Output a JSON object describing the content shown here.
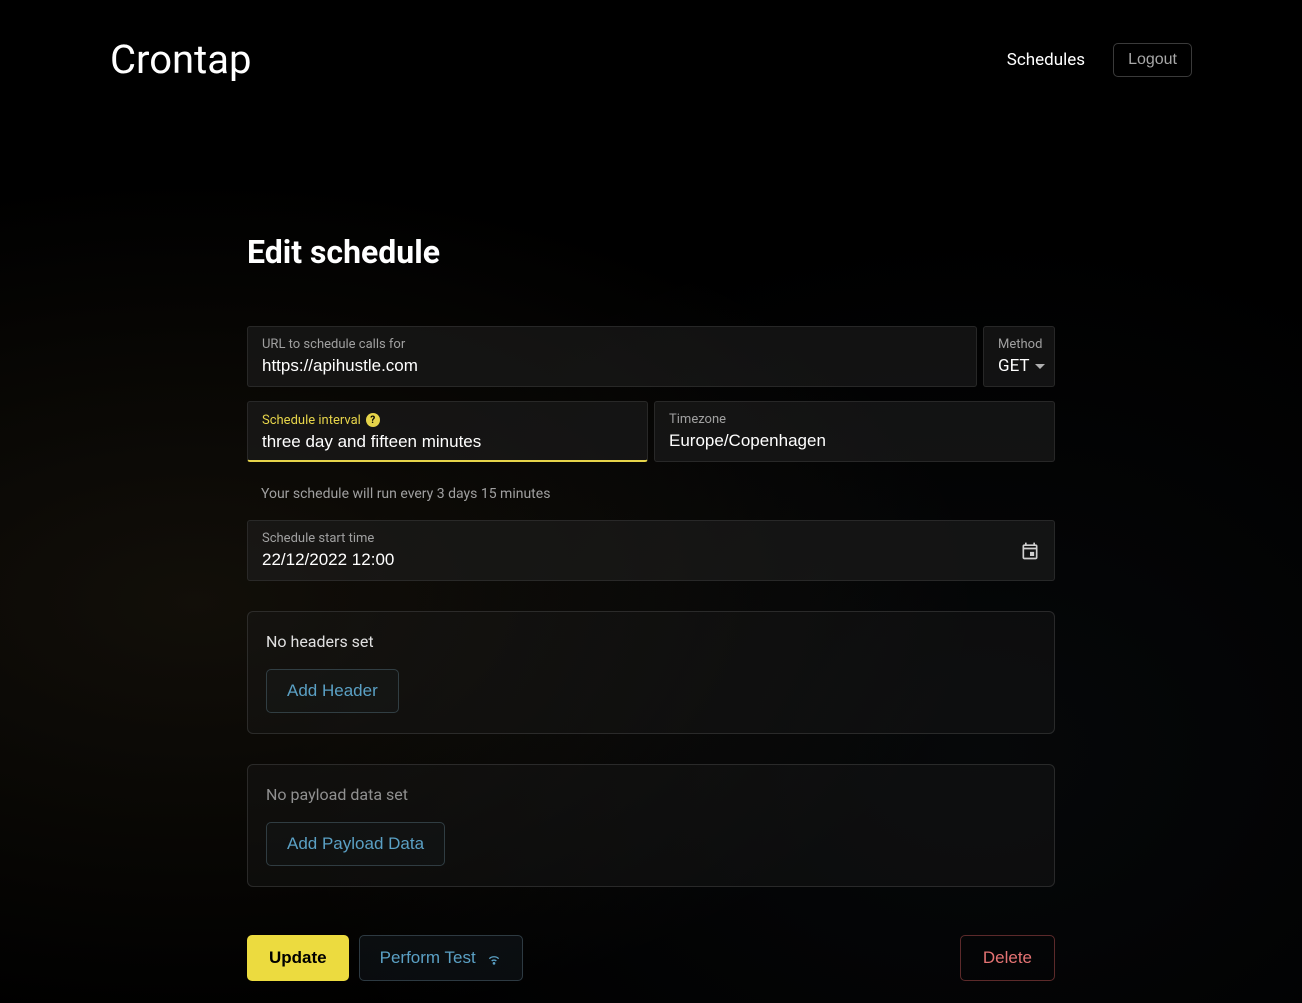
{
  "header": {
    "logo": "Crontap",
    "nav": {
      "schedules": "Schedules",
      "logout": "Logout"
    }
  },
  "page": {
    "title": "Edit schedule"
  },
  "form": {
    "url": {
      "label": "URL to schedule calls for",
      "value": "https://apihustle.com"
    },
    "method": {
      "label": "Method",
      "value": "GET"
    },
    "interval": {
      "label": "Schedule interval",
      "value": "three day and fifteen minutes",
      "help": "Your schedule will run every 3 days 15 minutes"
    },
    "timezone": {
      "label": "Timezone",
      "value": "Europe/Copenhagen"
    },
    "start_time": {
      "label": "Schedule start time",
      "value": "22/12/2022 12:00"
    },
    "headers": {
      "empty_text": "No headers set",
      "add_label": "Add Header"
    },
    "payload": {
      "empty_text": "No payload data set",
      "add_label": "Add Payload Data"
    }
  },
  "actions": {
    "update": "Update",
    "perform_test": "Perform Test",
    "delete": "Delete"
  }
}
